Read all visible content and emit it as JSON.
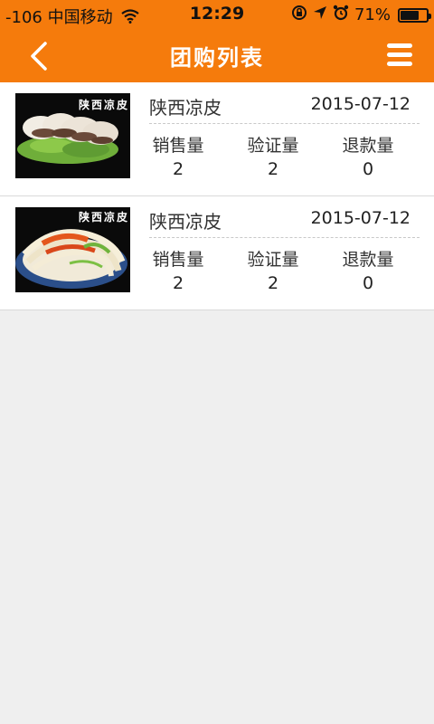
{
  "status_bar": {
    "signal": "-106",
    "carrier": "中国移动",
    "time": "12:29",
    "battery_percent": "71%",
    "battery_level": 0.71
  },
  "navbar": {
    "title": "团购列表",
    "back_icon": "chevron-left-icon",
    "menu_icon": "hamburger-menu-icon"
  },
  "colors": {
    "header": "#f57b0c",
    "background": "#efefef"
  },
  "items": [
    {
      "image_text": "陕西凉皮",
      "name": "陕西凉皮",
      "date": "2015-07-12",
      "stats": [
        {
          "label": "销售量",
          "value": "2"
        },
        {
          "label": "验证量",
          "value": "2"
        },
        {
          "label": "退款量",
          "value": "0"
        }
      ]
    },
    {
      "image_text": "陕西凉皮",
      "name": "陕西凉皮",
      "date": "2015-07-12",
      "stats": [
        {
          "label": "销售量",
          "value": "2"
        },
        {
          "label": "验证量",
          "value": "2"
        },
        {
          "label": "退款量",
          "value": "0"
        }
      ]
    }
  ]
}
